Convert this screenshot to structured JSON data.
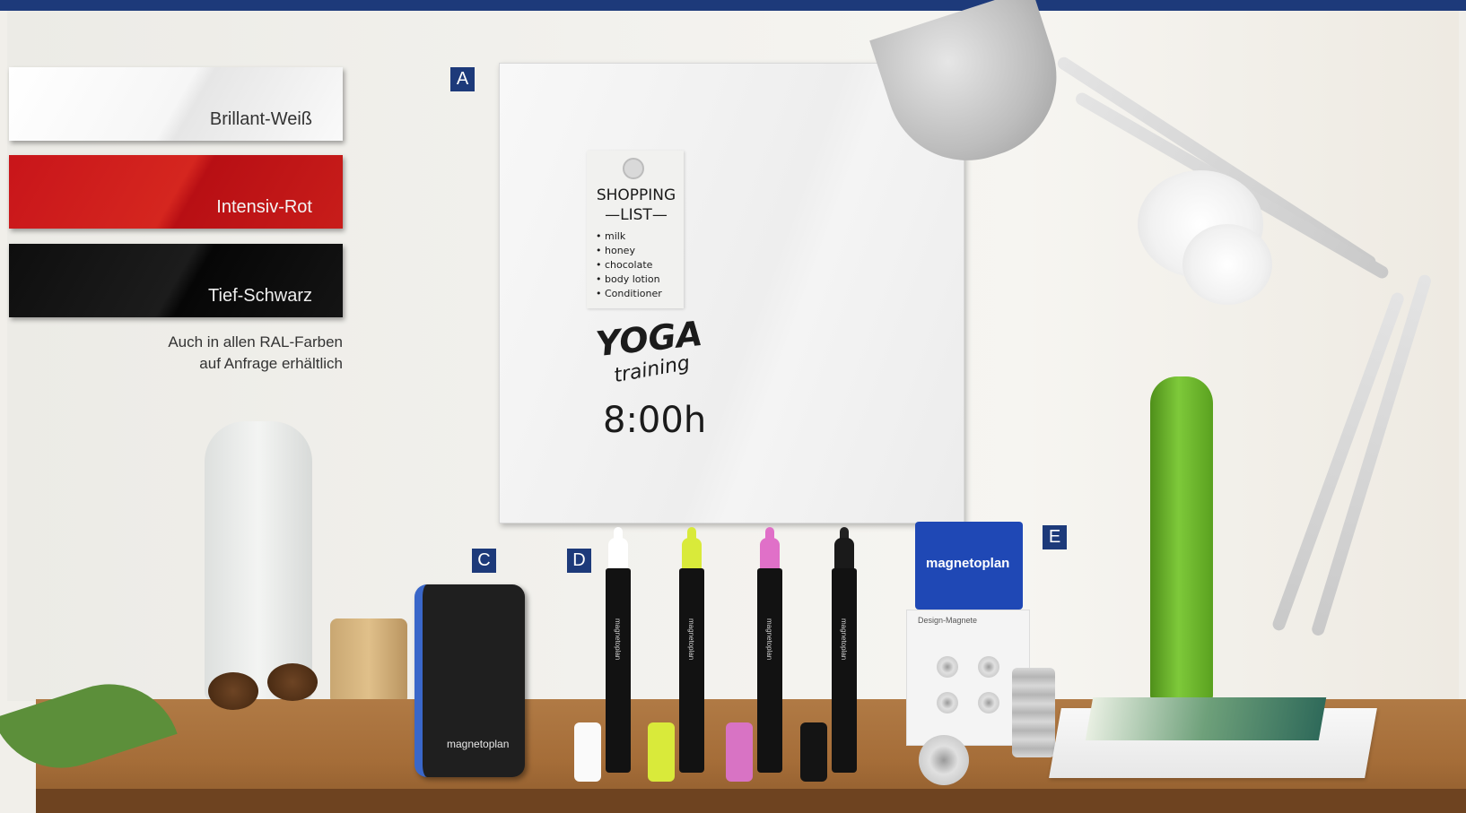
{
  "swatches": [
    {
      "name": "Brillant-Weiß",
      "color": "#f4f4f4"
    },
    {
      "name": "Intensiv-Rot",
      "color": "#c8151a"
    },
    {
      "name": "Tief-Schwarz",
      "color": "#111111"
    }
  ],
  "note": {
    "line1": "Auch in allen RAL-Farben",
    "line2": "auf Anfrage erhältlich"
  },
  "labels": {
    "a": "A",
    "c": "C",
    "d": "D",
    "e": "E"
  },
  "board": {
    "list_title": "SHOPPING",
    "list_subtitle": "—LIST—",
    "list_items": [
      "milk",
      "honey",
      "chocolate",
      "body lotion",
      "Conditioner"
    ],
    "yoga": "YOGA",
    "training": "training",
    "time": "8:00h"
  },
  "products": {
    "eraser_brand": "magnetoplan",
    "marker_brand": "magnetoplan",
    "pack_brand": "magnetoplan",
    "pack_subtitle": "Design-Magnete"
  },
  "colors": {
    "accent": "#1d3a7a",
    "marker_white": "#ffffff",
    "marker_yellow": "#d9ea3a",
    "marker_pink": "#e070c8",
    "marker_black": "#111111"
  }
}
